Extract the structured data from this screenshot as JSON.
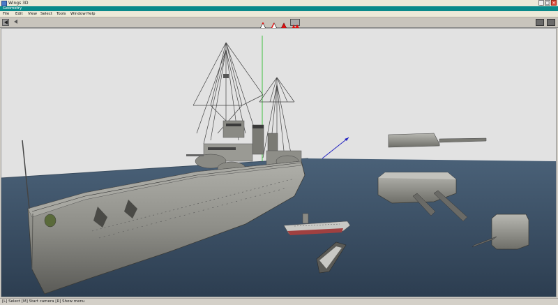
{
  "window": {
    "title": "Wings 3D"
  },
  "geometry_tab": {
    "label": "Geometry"
  },
  "menu": {
    "items": [
      "File",
      "Edit",
      "View",
      "Select",
      "Tools",
      "Window",
      "Help"
    ]
  },
  "status_bar": {
    "text": "[L] Select   [M] Start camera   [R] Show menu"
  },
  "colors": {
    "viewport_background": "#e2e2e2",
    "sea": "#3d5266",
    "geometry_tab": "#0a8a8a",
    "selection_highlight": "#e01010",
    "y_axis": "#40c040",
    "z_axis": "#2020c0"
  },
  "icons": {
    "back": "left-arrow-icon",
    "forward": "left-arrow-icon",
    "vertex_mode": "vertex-select-icon",
    "edge_mode": "edge-select-icon",
    "face_mode": "face-select-icon",
    "body_mode": "body-select-icon",
    "render_view_1": "view-icon",
    "render_view_2": "view-icon",
    "minimize": "minimize-icon",
    "maximize": "maximize-icon",
    "close": "close-icon"
  }
}
